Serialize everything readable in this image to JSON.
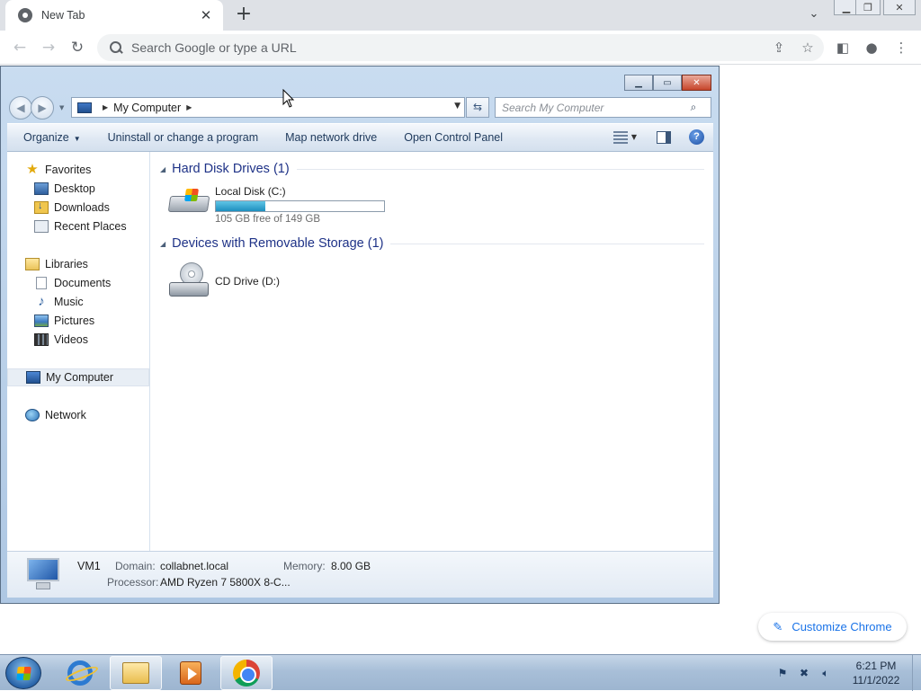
{
  "browser": {
    "tab_title": "New Tab",
    "omnibox_placeholder": "Search Google or type a URL",
    "customize_label": "Customize Chrome"
  },
  "explorer": {
    "address": "My Computer",
    "search_placeholder": "Search My Computer",
    "commands": [
      "Organize",
      "Uninstall or change a program",
      "Map network drive",
      "Open Control Panel"
    ],
    "nav": {
      "favorites": "Favorites",
      "desktop": "Desktop",
      "downloads": "Downloads",
      "recent": "Recent Places",
      "libraries": "Libraries",
      "documents": "Documents",
      "music": "Music",
      "pictures": "Pictures",
      "videos": "Videos",
      "computer": "My Computer",
      "network": "Network"
    },
    "groups": {
      "hdd": "Hard Disk Drives (1)",
      "removable": "Devices with Removable Storage (1)"
    },
    "drives": {
      "c_name": "Local Disk (C:)",
      "c_free": "105 GB free of 149 GB",
      "c_used_fraction": 0.295,
      "d_name": "CD Drive (D:)"
    },
    "details": {
      "name": "VM1",
      "domain_label": "Domain:",
      "domain_value": "collabnet.local",
      "memory_label": "Memory:",
      "memory_value": "8.00 GB",
      "processor_label": "Processor:",
      "processor_value": "AMD Ryzen 7 5800X 8-C..."
    }
  },
  "taskbar": {
    "time": "6:21 PM",
    "date": "11/1/2022"
  },
  "colors": {
    "accent": "#1a73e8",
    "group_header": "#1e3287",
    "disk_fill": "#1d8fbe"
  }
}
